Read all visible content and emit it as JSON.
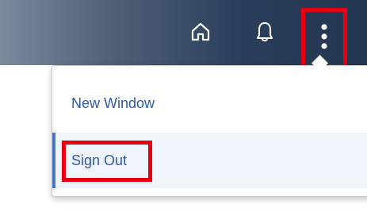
{
  "toolbar": {
    "icons": {
      "home": "home-icon",
      "notifications": "bell-icon",
      "more": "more-vertical-icon"
    },
    "colors": {
      "bar_start": "#7b8a9d",
      "bar_end": "#223650",
      "highlight": "#e60012",
      "menu_text": "#2e5aa8",
      "selected_bg": "#eff4fb"
    }
  },
  "menu": {
    "items": [
      {
        "label": "New Window"
      },
      {
        "label": "Sign Out"
      }
    ]
  }
}
